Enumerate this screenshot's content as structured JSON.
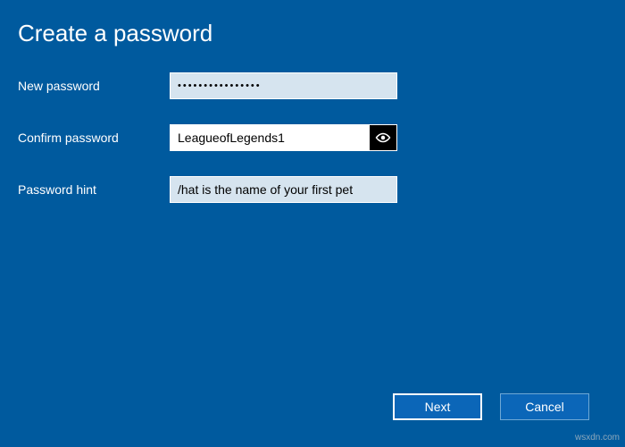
{
  "title": "Create a password",
  "labels": {
    "new_password": "New password",
    "confirm_password": "Confirm password",
    "password_hint": "Password hint"
  },
  "fields": {
    "new_password_value": "••••••••••••••••",
    "confirm_password_value": "LeagueofLegends1",
    "password_hint_value": "/hat is the name of your first pet"
  },
  "icons": {
    "reveal": "eye-reveal-icon"
  },
  "buttons": {
    "next": "Next",
    "cancel": "Cancel"
  },
  "watermark": "wsxdn.com"
}
